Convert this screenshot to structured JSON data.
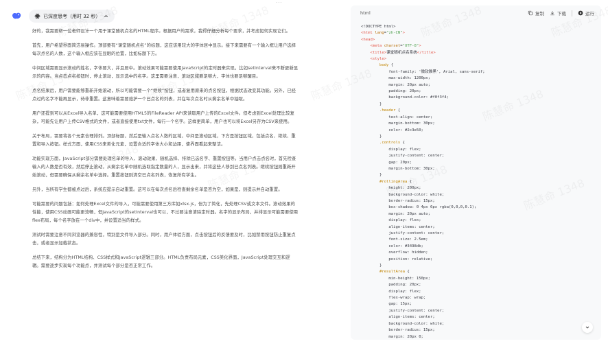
{
  "chat": {
    "top_dots": "···",
    "thinking_label": "已深度思考（用时 32 秒）",
    "paragraphs": [
      "好的，我需要帮一位老师设计一个用于课堂随机点名的HTML程序。根据用户的需求，我得仔细分析每个要求，并考虑如何实现它们。",
      "首先，用户希望界面简洁易操作。顶部要有“课堂随机点名”的标题，这应该用较大的字体居中显示。接下来需要有一个输入框让用户选择每次点名的人数，这个输入框应该在显眼的位置，比如标题下方。",
      "中间区域需要显示滚动的姓名，字体要大，并且居中。滚动效果可能需要使用JavaScript的定时器来实现，比如setInterval来不断更新显示的内容。当点击点名按钮时，停止滚动，显示选中的名字。这里需要注意，滚动区域要足够大，字体也要足够醒目。",
      "点名结果后，用户需要能够重新开始滚动，所以可能需要一个“继续”按钮，或者复用原来的点名按钮，根据状态改变其功能。另外，已经点过的名字不能再显示，待非重置。这意味着需要维护一个已点名的列表，并在每次点名时从剩余名单中抽取。",
      "用户还提到可以从Excel导入名单，这可能需要使用HTML5的FileReader API来读取用户上传的Excel文件。但考虑到Excel处理比较复杂，可能先让用户上传CSV格式的文件，或者直接使用txt文件，每行一个名字。这样更简单，用户也可以将Excel另存为CSV来使用。",
      "关于布局，需要将各个元素合理排列。顶部标题，然后是输入点名人数的区域，中间是滚动区域，下方是按钮区域，包括点名、继续、重置和导入按钮。样式方面，使用CSS来美化元素，设置合适的字体大小和边距，使界面看起来整洁。",
      "功能实现方面，JavaScript部分需要处理名单的导入、滚动效果、随机选择、排除已选名字、重置按钮等。当用户点击点名时，首先检查输入的人数是否有效，然后停止滚动，从剩余名单中随机选取指定数量的人，显示出来，并将这些人移到已点名列表。继续按钮则重新开始滚动，但需要确保从剩余名单中选择。重置按钮则清空已点名列表，恢复所有学生。",
      "另外，当所有学生都被点过后，系统应提示自动重置。这可以在每次点名后检查剩余名单是否为空，如果是，则提示并自动重置。",
      "可能需要的问题包括：如何处理Excel文件的导入，可能需要使用第三方库如xlsx.js，但为了简化，先处理CSV或文本文件。滚动效果的性能，使用CSS动画可能更流畅，但JavaScript的setInterval也可以，不过要注意清除定时器。名字的显示布局，并排显示可能需要使用flex布局，每个名字放在一个div中，并设置适当的样式。",
      "测试时需要注意不同浏览器的兼容性，特别是文件导入部分。同时，用户体验方面，点击按钮后的反馈要及时，比如禁用按钮防止重复点击，或者显示加载状态。",
      "总结下来，结构分为HTML结构、CSS样式和JavaScript逻辑三部分。HTML负责布局元素，CSS美化界面，JavaScript处理交互和逻辑。需要逐步实现每个功能点，并测试每个部分是否正常工作。"
    ]
  },
  "code_panel": {
    "language": "html",
    "copy_label": "复制",
    "download_label": "下载",
    "run_label": "运行"
  },
  "code_lines": [
    [
      [
        "punc",
        "<!DOCTYPE html>"
      ]
    ],
    [
      [
        "tag",
        "<html "
      ],
      [
        "attr",
        "lang"
      ],
      [
        "punc",
        "="
      ],
      [
        "str",
        "\"zh-CN\""
      ],
      [
        "tag",
        ">"
      ]
    ],
    [
      [
        "tag",
        "<head>"
      ]
    ],
    [
      [
        "punc",
        "    "
      ],
      [
        "tag",
        "<meta "
      ],
      [
        "attr",
        "charset"
      ],
      [
        "punc",
        "="
      ],
      [
        "str",
        "\"UTF-8\""
      ],
      [
        "tag",
        ">"
      ]
    ],
    [
      [
        "punc",
        "    "
      ],
      [
        "tag",
        "<title>"
      ],
      [
        "punc",
        "课堂随机点名系统"
      ],
      [
        "tag",
        "</title>"
      ]
    ],
    [
      [
        "punc",
        "    "
      ],
      [
        "tag",
        "<style>"
      ]
    ],
    [
      [
        "punc",
        "        "
      ],
      [
        "sel",
        "body"
      ],
      [
        "punc",
        " {"
      ]
    ],
    [
      [
        "punc",
        "            font-family: '微软雅黑', Arial, sans-serif;"
      ]
    ],
    [
      [
        "punc",
        "            max-width: 1200px;"
      ]
    ],
    [
      [
        "punc",
        "            margin: 20px auto;"
      ]
    ],
    [
      [
        "punc",
        "            padding: 20px;"
      ]
    ],
    [
      [
        "punc",
        "            background-color: #f0f3f4;"
      ]
    ],
    [
      [
        "punc",
        "        }"
      ]
    ],
    [
      [
        "punc",
        "        "
      ],
      [
        "sel",
        ".header"
      ],
      [
        "punc",
        " {"
      ]
    ],
    [
      [
        "punc",
        "            text-align: center;"
      ]
    ],
    [
      [
        "punc",
        "            margin-bottom: 30px;"
      ]
    ],
    [
      [
        "punc",
        "            color: #2c3e50;"
      ]
    ],
    [
      [
        "punc",
        "        }"
      ]
    ],
    [
      [
        "punc",
        "        "
      ],
      [
        "sel",
        ".controls"
      ],
      [
        "punc",
        " {"
      ]
    ],
    [
      [
        "punc",
        "            display: flex;"
      ]
    ],
    [
      [
        "punc",
        "            justify-content: center;"
      ]
    ],
    [
      [
        "punc",
        "            gap: 20px;"
      ]
    ],
    [
      [
        "punc",
        "            margin-bottom: 30px;"
      ]
    ],
    [
      [
        "punc",
        "        }"
      ]
    ],
    [
      [
        "punc",
        "        "
      ],
      [
        "sel",
        "#rollingArea"
      ],
      [
        "punc",
        " {"
      ]
    ],
    [
      [
        "punc",
        "            height: 200px;"
      ]
    ],
    [
      [
        "punc",
        "            background-color: white;"
      ]
    ],
    [
      [
        "punc",
        "            border-radius: 15px;"
      ]
    ],
    [
      [
        "punc",
        "            box-shadow: 0 4px 6px rgba(0,0,0,0.1);"
      ]
    ],
    [
      [
        "punc",
        "            margin: 20px auto;"
      ]
    ],
    [
      [
        "punc",
        "            display: flex;"
      ]
    ],
    [
      [
        "punc",
        "            align-items: center;"
      ]
    ],
    [
      [
        "punc",
        "            justify-content: center;"
      ]
    ],
    [
      [
        "punc",
        "            font-size: 2.5em;"
      ]
    ],
    [
      [
        "punc",
        "            color: #3498db;"
      ]
    ],
    [
      [
        "punc",
        "            overflow: hidden;"
      ]
    ],
    [
      [
        "punc",
        "            position: relative;"
      ]
    ],
    [
      [
        "punc",
        "        }"
      ]
    ],
    [
      [
        "punc",
        "        "
      ],
      [
        "sel",
        "#resultArea"
      ],
      [
        "punc",
        " {"
      ]
    ],
    [
      [
        "punc",
        "            min-height: 150px;"
      ]
    ],
    [
      [
        "punc",
        "            padding: 20px;"
      ]
    ],
    [
      [
        "punc",
        "            display: flex;"
      ]
    ],
    [
      [
        "punc",
        "            flex-wrap: wrap;"
      ]
    ],
    [
      [
        "punc",
        "            gap: 15px;"
      ]
    ],
    [
      [
        "punc",
        "            justify-content: center;"
      ]
    ],
    [
      [
        "punc",
        "            align-items: center;"
      ]
    ],
    [
      [
        "punc",
        "            background-color: white;"
      ]
    ],
    [
      [
        "punc",
        "            border-radius: 15px;"
      ]
    ],
    [
      [
        "punc",
        "            margin: 20px 0;"
      ]
    ]
  ],
  "watermarks": [
    "陈慧命 1348",
    "陈慧命 1348",
    "陈慧命 1348",
    "陈慧命 1348",
    "陈慧命 1348",
    "陈慧命 1348",
    "陈慧命 1348",
    "陈慧命 1348",
    "陈慧命 1348",
    "陈慧命 1348",
    "陈慧命 1348",
    "陈慧命 1348"
  ]
}
